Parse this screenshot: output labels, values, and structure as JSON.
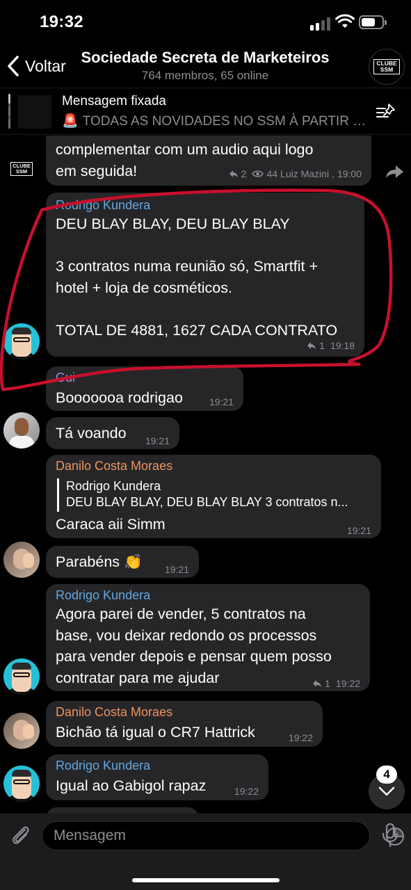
{
  "status": {
    "time": "19:32",
    "battery_level": 0.6
  },
  "header": {
    "back_label": "Voltar",
    "title": "Sociedade Secreta de Marketeiros",
    "subtitle": "764 membros, 65 online",
    "avatar_text": "CLUBE\nSSM"
  },
  "pinned": {
    "title": "Mensagem fixada",
    "icon": "siren-icon",
    "text": "TODAS AS NOVIDADES NO SSM À PARTIR DE AGORA"
  },
  "messages": [
    {
      "id": "m0",
      "sender": "",
      "text": "complementar com um audio aqui logo\nem seguida!",
      "replies": "2",
      "views": "44",
      "author_sig": "Luiz Mazini",
      "time": "19:00",
      "avatar_text": "CLUBE\nSSM"
    },
    {
      "id": "m1",
      "sender": "Rodrigo Kundera",
      "text": "DEU BLAY BLAY, DEU BLAY BLAY\n\n3 contratos numa reunião só, Smartfit +\nhotel + loja de cosméticos.\n\nTOTAL DE 4881, 1627 CADA CONTRATO",
      "replies": "1",
      "time": "19:18"
    },
    {
      "id": "m2",
      "sender": "Gui",
      "text": "Booooooa rodrigao",
      "time": "19:21"
    },
    {
      "id": "m3",
      "sender": "",
      "text": "Tá voando",
      "time": "19:21"
    },
    {
      "id": "m4",
      "sender": "Danilo Costa Moraes",
      "quote_author": "Rodrigo Kundera",
      "quote_text": "DEU BLAY BLAY, DEU BLAY BLAY 3 contratos n...",
      "text": "Caraca aii Simm",
      "time": "19:21"
    },
    {
      "id": "m5",
      "sender": "",
      "text": "Parabéns 👏",
      "time": "19:21"
    },
    {
      "id": "m6",
      "sender": "Rodrigo Kundera",
      "text": "Agora parei de vender, 5 contratos na\nbase, vou deixar redondo os processos\npara vender depois e pensar quem posso\ncontratar para me ajudar",
      "replies": "1",
      "time": "19:22"
    },
    {
      "id": "m7",
      "sender": "Danilo Costa Moraes",
      "text": "Bichão tá igual o CR7 Hattrick",
      "time": "19:22"
    },
    {
      "id": "m8",
      "sender": "Rodrigo Kundera",
      "text": "Igual ao Gabigol rapaz",
      "time": "19:22"
    }
  ],
  "colors": {
    "rodrigo": "#63a8e2",
    "gui": "#b387e8",
    "danilo": "#ee9460",
    "annotation": "#c8102e"
  },
  "scroll": {
    "unread_count": "4"
  },
  "input": {
    "placeholder": "Mensagem"
  }
}
